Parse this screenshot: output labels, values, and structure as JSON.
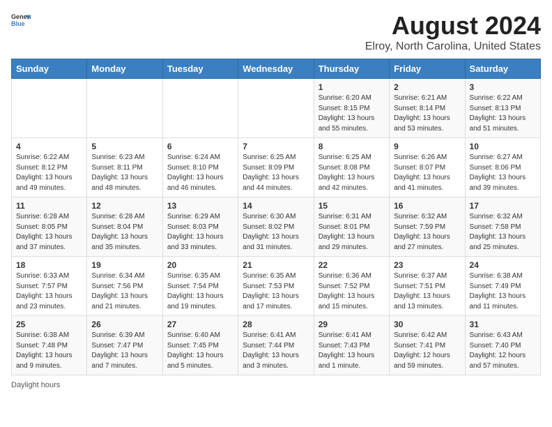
{
  "header": {
    "logo_general": "General",
    "logo_blue": "Blue",
    "title": "August 2024",
    "subtitle": "Elroy, North Carolina, United States"
  },
  "calendar": {
    "days_of_week": [
      "Sunday",
      "Monday",
      "Tuesday",
      "Wednesday",
      "Thursday",
      "Friday",
      "Saturday"
    ],
    "weeks": [
      [
        {
          "day": "",
          "info": ""
        },
        {
          "day": "",
          "info": ""
        },
        {
          "day": "",
          "info": ""
        },
        {
          "day": "",
          "info": ""
        },
        {
          "day": "1",
          "info": "Sunrise: 6:20 AM\nSunset: 8:15 PM\nDaylight: 13 hours\nand 55 minutes."
        },
        {
          "day": "2",
          "info": "Sunrise: 6:21 AM\nSunset: 8:14 PM\nDaylight: 13 hours\nand 53 minutes."
        },
        {
          "day": "3",
          "info": "Sunrise: 6:22 AM\nSunset: 8:13 PM\nDaylight: 13 hours\nand 51 minutes."
        }
      ],
      [
        {
          "day": "4",
          "info": "Sunrise: 6:22 AM\nSunset: 8:12 PM\nDaylight: 13 hours\nand 49 minutes."
        },
        {
          "day": "5",
          "info": "Sunrise: 6:23 AM\nSunset: 8:11 PM\nDaylight: 13 hours\nand 48 minutes."
        },
        {
          "day": "6",
          "info": "Sunrise: 6:24 AM\nSunset: 8:10 PM\nDaylight: 13 hours\nand 46 minutes."
        },
        {
          "day": "7",
          "info": "Sunrise: 6:25 AM\nSunset: 8:09 PM\nDaylight: 13 hours\nand 44 minutes."
        },
        {
          "day": "8",
          "info": "Sunrise: 6:25 AM\nSunset: 8:08 PM\nDaylight: 13 hours\nand 42 minutes."
        },
        {
          "day": "9",
          "info": "Sunrise: 6:26 AM\nSunset: 8:07 PM\nDaylight: 13 hours\nand 41 minutes."
        },
        {
          "day": "10",
          "info": "Sunrise: 6:27 AM\nSunset: 8:06 PM\nDaylight: 13 hours\nand 39 minutes."
        }
      ],
      [
        {
          "day": "11",
          "info": "Sunrise: 6:28 AM\nSunset: 8:05 PM\nDaylight: 13 hours\nand 37 minutes."
        },
        {
          "day": "12",
          "info": "Sunrise: 6:28 AM\nSunset: 8:04 PM\nDaylight: 13 hours\nand 35 minutes."
        },
        {
          "day": "13",
          "info": "Sunrise: 6:29 AM\nSunset: 8:03 PM\nDaylight: 13 hours\nand 33 minutes."
        },
        {
          "day": "14",
          "info": "Sunrise: 6:30 AM\nSunset: 8:02 PM\nDaylight: 13 hours\nand 31 minutes."
        },
        {
          "day": "15",
          "info": "Sunrise: 6:31 AM\nSunset: 8:01 PM\nDaylight: 13 hours\nand 29 minutes."
        },
        {
          "day": "16",
          "info": "Sunrise: 6:32 AM\nSunset: 7:59 PM\nDaylight: 13 hours\nand 27 minutes."
        },
        {
          "day": "17",
          "info": "Sunrise: 6:32 AM\nSunset: 7:58 PM\nDaylight: 13 hours\nand 25 minutes."
        }
      ],
      [
        {
          "day": "18",
          "info": "Sunrise: 6:33 AM\nSunset: 7:57 PM\nDaylight: 13 hours\nand 23 minutes."
        },
        {
          "day": "19",
          "info": "Sunrise: 6:34 AM\nSunset: 7:56 PM\nDaylight: 13 hours\nand 21 minutes."
        },
        {
          "day": "20",
          "info": "Sunrise: 6:35 AM\nSunset: 7:54 PM\nDaylight: 13 hours\nand 19 minutes."
        },
        {
          "day": "21",
          "info": "Sunrise: 6:35 AM\nSunset: 7:53 PM\nDaylight: 13 hours\nand 17 minutes."
        },
        {
          "day": "22",
          "info": "Sunrise: 6:36 AM\nSunset: 7:52 PM\nDaylight: 13 hours\nand 15 minutes."
        },
        {
          "day": "23",
          "info": "Sunrise: 6:37 AM\nSunset: 7:51 PM\nDaylight: 13 hours\nand 13 minutes."
        },
        {
          "day": "24",
          "info": "Sunrise: 6:38 AM\nSunset: 7:49 PM\nDaylight: 13 hours\nand 11 minutes."
        }
      ],
      [
        {
          "day": "25",
          "info": "Sunrise: 6:38 AM\nSunset: 7:48 PM\nDaylight: 13 hours\nand 9 minutes."
        },
        {
          "day": "26",
          "info": "Sunrise: 6:39 AM\nSunset: 7:47 PM\nDaylight: 13 hours\nand 7 minutes."
        },
        {
          "day": "27",
          "info": "Sunrise: 6:40 AM\nSunset: 7:45 PM\nDaylight: 13 hours\nand 5 minutes."
        },
        {
          "day": "28",
          "info": "Sunrise: 6:41 AM\nSunset: 7:44 PM\nDaylight: 13 hours\nand 3 minutes."
        },
        {
          "day": "29",
          "info": "Sunrise: 6:41 AM\nSunset: 7:43 PM\nDaylight: 13 hours\nand 1 minute."
        },
        {
          "day": "30",
          "info": "Sunrise: 6:42 AM\nSunset: 7:41 PM\nDaylight: 12 hours\nand 59 minutes."
        },
        {
          "day": "31",
          "info": "Sunrise: 6:43 AM\nSunset: 7:40 PM\nDaylight: 12 hours\nand 57 minutes."
        }
      ]
    ]
  },
  "footer": {
    "note": "Daylight hours"
  }
}
